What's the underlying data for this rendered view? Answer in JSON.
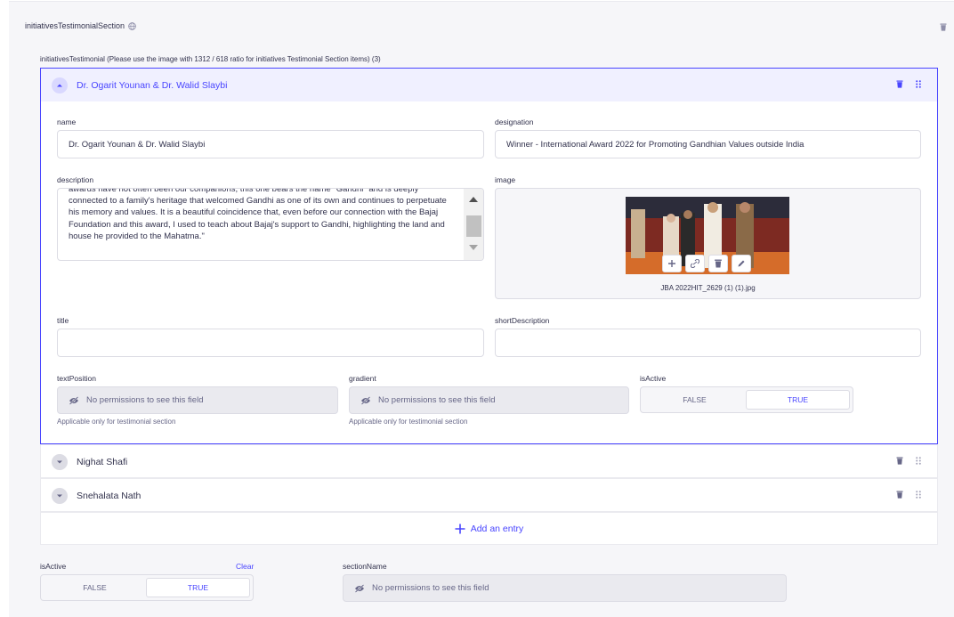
{
  "section": {
    "label": "initiativesTestimonialSection",
    "list_label": "initiativesTestimonial (Please use the image with 1312 / 618 ratio for initiatives Testimonial Section items) (3)"
  },
  "entries": [
    {
      "title": "Dr. Ogarit Younan & Dr. Walid Slaybi",
      "fields": {
        "name_label": "name",
        "name_value": "Dr. Ogarit Younan & Dr. Walid Slaybi",
        "designation_label": "designation",
        "designation_value": "Winner - International Award 2022 for Promoting Gandhian Values outside India",
        "description_label": "description",
        "description_value": "awards have not often been our companions, this one bears the name \"Gandhi\" and is deeply connected to a family's heritage that welcomed Gandhi as one of its own and continues to perpetuate his memory and values. It is a beautiful coincidence that, even before our connection with the Bajaj Foundation and this award, I used to teach about Bajaj's support to Gandhi, highlighting the land and house he provided to the Mahatma.\"",
        "image_label": "image",
        "image_filename": "JBA 2022HIT_2629 (1) (1).jpg",
        "title_label": "title",
        "title_value": "",
        "short_description_label": "shortDescription",
        "short_description_value": "",
        "text_position_label": "textPosition",
        "text_position_placeholder": "No permissions to see this field",
        "text_position_hint": "Applicable only for testimonial section",
        "gradient_label": "gradient",
        "gradient_placeholder": "No permissions to see this field",
        "gradient_hint": "Applicable only for testimonial section",
        "is_active_label": "isActive",
        "is_active_false": "FALSE",
        "is_active_true": "TRUE",
        "is_active_value": true
      }
    },
    {
      "title": "Nighat Shafi"
    },
    {
      "title": "Snehalata Nath"
    }
  ],
  "add_entry_label": "Add an entry",
  "bottom": {
    "is_active_label": "isActive",
    "clear_label": "Clear",
    "false_label": "FALSE",
    "true_label": "TRUE",
    "is_active_value": true,
    "section_name_label": "sectionName",
    "section_name_placeholder": "No permissions to see this field"
  },
  "colors": {
    "accent": "#4945ff",
    "text": "#32324d",
    "muted": "#666687",
    "border": "#dcdce4",
    "disabled_bg": "#eaeaef",
    "open_header_bg": "#f0f0ff"
  },
  "icons": [
    "globe-icon",
    "trash-icon",
    "drag-handle-icon",
    "chevron-up-icon",
    "chevron-down-icon",
    "eye-slash-icon",
    "plus-icon",
    "link-icon",
    "pencil-icon"
  ]
}
